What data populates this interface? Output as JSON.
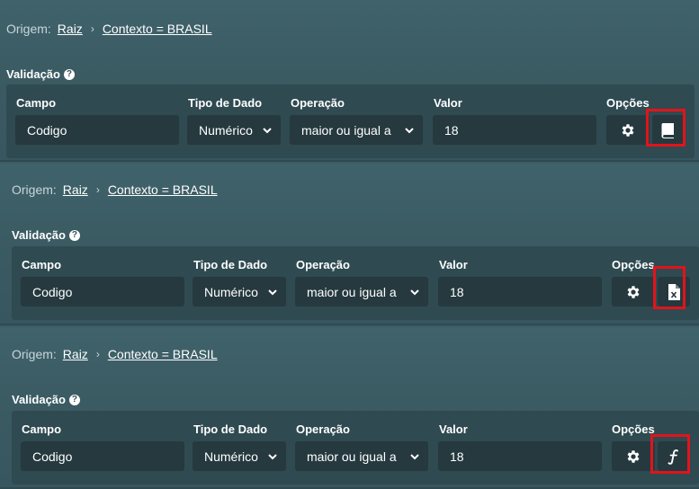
{
  "panels": [
    {
      "breadcrumb": {
        "label": "Origem:",
        "root": "Raiz",
        "separator": "›",
        "context": "Contexto = BRASIL"
      },
      "section_title": "Validação",
      "columns": {
        "campo": "Campo",
        "tipo": "Tipo de Dado",
        "operacao": "Operação",
        "valor": "Valor",
        "opcoes": "Opções"
      },
      "values": {
        "campo": "Codigo",
        "tipo": "Numérico",
        "operacao": "maior ou igual a",
        "valor": "18"
      },
      "option_icon": "document-scroll-icon",
      "highlighted": true
    },
    {
      "breadcrumb": {
        "label": "Origem:",
        "root": "Raiz",
        "separator": "›",
        "context": "Contexto = BRASIL"
      },
      "section_title": "Validação",
      "columns": {
        "campo": "Campo",
        "tipo": "Tipo de Dado",
        "operacao": "Operação",
        "valor": "Valor",
        "opcoes": "Opções"
      },
      "values": {
        "campo": "Codigo",
        "tipo": "Numérico",
        "operacao": "maior ou igual a",
        "valor": "18"
      },
      "option_icon": "excel-file-icon",
      "highlighted": true
    },
    {
      "breadcrumb": {
        "label": "Origem:",
        "root": "Raiz",
        "separator": "›",
        "context": "Contexto = BRASIL"
      },
      "section_title": "Validação",
      "columns": {
        "campo": "Campo",
        "tipo": "Tipo de Dado",
        "operacao": "Operação",
        "valor": "Valor",
        "opcoes": "Opções"
      },
      "values": {
        "campo": "Codigo",
        "tipo": "Numérico",
        "operacao": "maior ou igual a",
        "valor": "18"
      },
      "option_icon": "function-icon",
      "highlighted": true
    }
  ],
  "icons": {
    "settings": "gear-icon",
    "help": "question-circle-icon",
    "caret": "chevron-down-icon"
  },
  "colors": {
    "background": "#3d5b63",
    "box": "#2f4a51",
    "input": "#25393f",
    "highlight": "#e3131b"
  }
}
